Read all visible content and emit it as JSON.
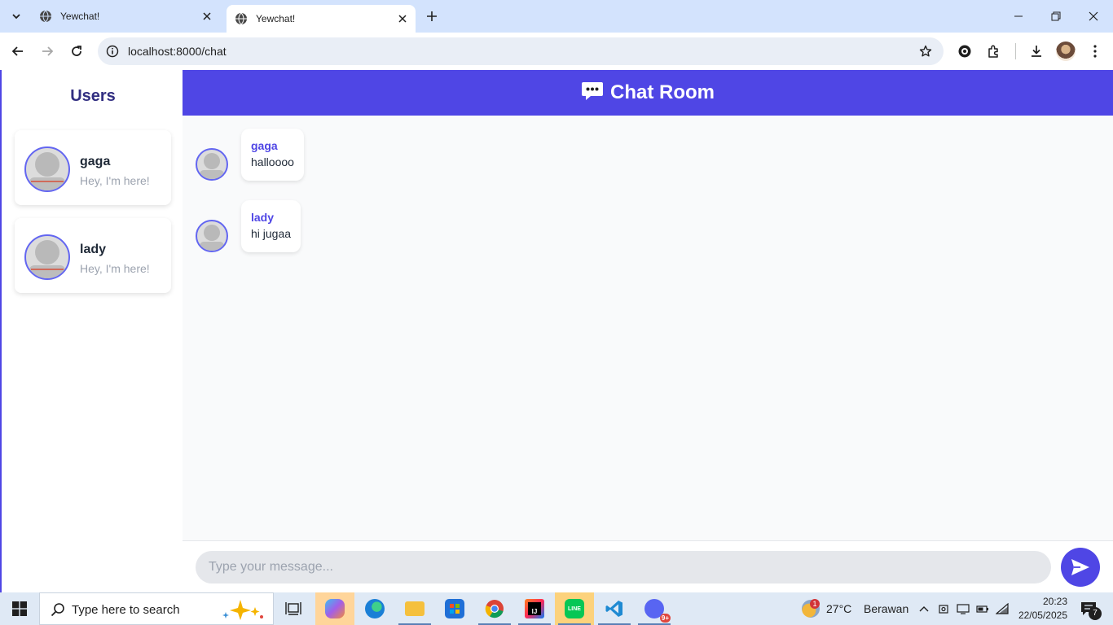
{
  "browser": {
    "tabs": [
      {
        "title": "Yewchat!",
        "active": false
      },
      {
        "title": "Yewchat!",
        "active": true
      }
    ],
    "url": "localhost:8000/chat"
  },
  "sidebar": {
    "title": "Users",
    "users": [
      {
        "name": "gaga",
        "status": "Hey, I'm here!"
      },
      {
        "name": "lady",
        "status": "Hey, I'm here!"
      }
    ]
  },
  "chat": {
    "title": "Chat Room",
    "messages": [
      {
        "from": "gaga",
        "text": "halloooo"
      },
      {
        "from": "lady",
        "text": "hi jugaa"
      }
    ],
    "input_placeholder": "Type your message...",
    "input_value": ""
  },
  "taskbar": {
    "search_placeholder": "Type here to search",
    "weather": {
      "temp": "27°C",
      "condition": "Berawan",
      "badge": "1"
    },
    "time": "20:23",
    "date": "22/05/2025",
    "notification_count": "7",
    "edge_badge": "9+"
  },
  "colors": {
    "accent": "#4f46e5",
    "sidebar_title": "#312e81",
    "chrome_tabbar": "#d3e3fd",
    "taskbar": "#dfe9f5"
  }
}
